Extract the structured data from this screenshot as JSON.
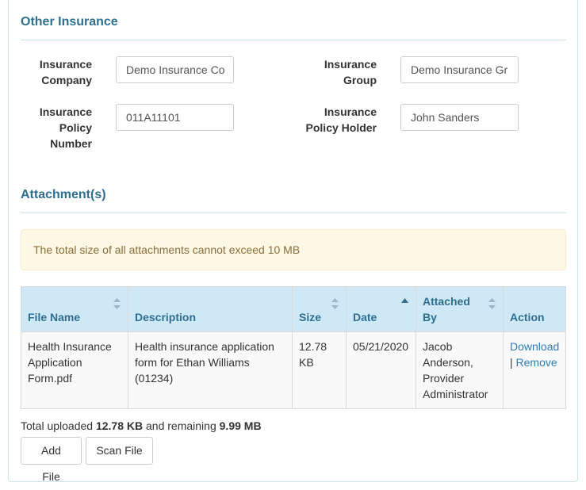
{
  "other_insurance": {
    "title": "Other Insurance",
    "insurance_company": {
      "label_line1": "Insurance",
      "label_line2": "Company",
      "value": "Demo Insurance Co"
    },
    "insurance_group": {
      "label_line1": "Insurance",
      "label_line2": "Group",
      "value": "Demo Insurance Gr"
    },
    "policy_number": {
      "label_line1": "Insurance",
      "label_line2": "Policy",
      "label_line3": "Number",
      "value": "011A11101"
    },
    "policy_holder": {
      "label_line1": "Insurance",
      "label_line2": "Policy Holder",
      "value": "John Sanders"
    }
  },
  "attachments": {
    "title": "Attachment(s)",
    "alert": "The total size of all attachments cannot exceed 10 MB",
    "columns": {
      "file_name": "File Name",
      "description": "Description",
      "size": "Size",
      "date": "Date",
      "attached_by_line1": "Attached",
      "attached_by_line2": "By",
      "action": "Action"
    },
    "rows": [
      {
        "file_name": "Health Insurance Application Form.pdf",
        "description": "Health insurance application form for Ethan Williams (01234)",
        "size": "12.78 KB",
        "date": "05/21/2020",
        "attached_by": "Jacob Anderson, Provider Administrator",
        "download_label": "Download",
        "separator": "|",
        "remove_label": "Remove"
      }
    ],
    "summary": {
      "prefix": "Total uploaded",
      "uploaded": "12.78 KB",
      "middle": "and remaining",
      "remaining": "9.99 MB"
    },
    "add_file_label": "Add File",
    "scan_file_label": "Scan File"
  },
  "colors": {
    "heading": "#2e6f8e",
    "table_header_bg": "#cfe8f5",
    "alert_bg": "#fcf8e3",
    "alert_text": "#8a6d3b",
    "link": "#2e7bb0"
  }
}
